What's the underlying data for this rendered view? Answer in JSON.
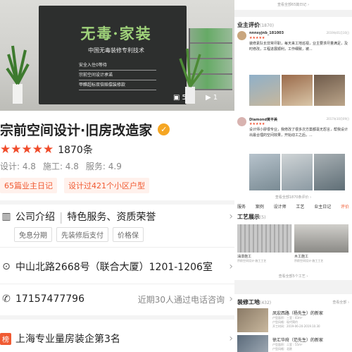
{
  "hero": {
    "title": "无毒·家装",
    "subtitle": "中国无毒装修专利技术",
    "lines": [
      "安全入住0等待",
      "宗前空间设计承诺",
      "甲醛超标双倍赔偿装修款"
    ],
    "photo_count": "5",
    "video_count": "1"
  },
  "company": {
    "name": "宗前空间设计·旧房改造家",
    "review_count": "1870条",
    "scores": [
      "设计: 4.8",
      "施工: 4.8",
      "服务: 4.9"
    ],
    "tags": [
      "65篇业主日记",
      "设计过421个小区户型"
    ]
  },
  "intro": {
    "label": "公司介绍",
    "features": "特色服务、资质荣誉",
    "chips": [
      "免息分期",
      "先装修后支付",
      "价格保"
    ]
  },
  "address": "中山北路2668号（联合大厦）1201-1206室",
  "phone": {
    "number": "17157477796",
    "hint": "近期30人通过电话咨询"
  },
  "bottom": {
    "badge": "榜",
    "text": "上海专业量房装企第3名"
  },
  "right": {
    "top_link": "查看全部65篇日记 ›",
    "reviews_title": "业主评价",
    "reviews_count": "(1870)",
    "reviews": [
      {
        "name": "nnnsyjnb_181003",
        "date": "2019年01月10日",
        "text": "装修素队长非常尽职，每天来工地巡视，业主要求尽量满足，及时修改，工程进展顺利，工作细致，被..."
      },
      {
        "name": "Diamond黄平美",
        "date": "2017年10月09日",
        "text": "设计师小廖很专业，我修改了很多次方案都毫无怨言，帮我设计出最合理的空间效果，开始动工之后，..."
      }
    ],
    "all_reviews_link": "查看全部1870条评价 ›",
    "tabs": [
      "服务",
      "案例",
      "设计师",
      "工艺",
      "业主日记",
      "评价"
    ],
    "craft_title": "工艺展示",
    "craft_count": "(5)",
    "crafts": [
      {
        "label": "油漆施工",
        "sub": "宗前空间设计·施工工艺"
      },
      {
        "label": "木工施工",
        "sub": "宗前空间设计·施工工艺"
      }
    ],
    "craft_link": "查看全部5个工艺 ›",
    "site_title": "装修工地",
    "site_count": "(432)",
    "site_link": "查看全部 ›",
    "sites": [
      {
        "name": "凤宏西路（杨先生）的新家",
        "meta": [
          "户型面积：三室｜43m²",
          "户型风格：现代简约",
          "开工时间：2019-06-20-2019.10.30"
        ]
      },
      {
        "name": "徐汇华府（范先生）的新家",
        "meta": [
          "户型面积：二室｜55m²",
          "户型风格：北欧"
        ]
      }
    ]
  }
}
